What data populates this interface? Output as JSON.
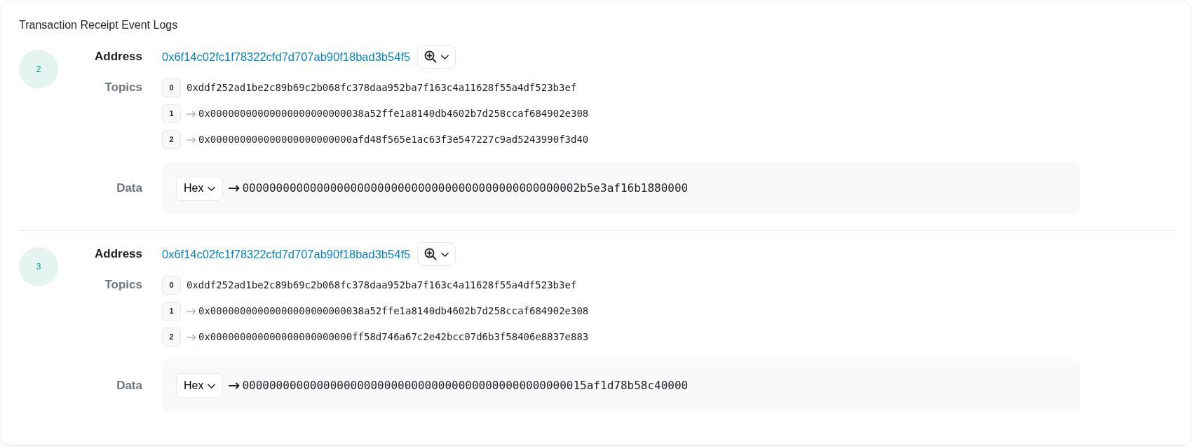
{
  "title": "Transaction Receipt Event Logs",
  "logs": [
    {
      "index": "2",
      "address_label": "Address",
      "address": "0x6f14c02fc1f78322cfd7d707ab90f18bad3b54f5",
      "topics_label": "Topics",
      "topics": [
        {
          "index": "0",
          "arrow": false,
          "value": "0xddf252ad1be2c89b69c2b068fc378daa952ba7f163c4a11628f55a4df523b3ef"
        },
        {
          "index": "1",
          "arrow": true,
          "value": "0x00000000000000000000000038a52ffe1a8140db4602b7d258ccaf684902e308"
        },
        {
          "index": "2",
          "arrow": true,
          "value": "0x000000000000000000000000afd48f565e1ac63f3e547227c9ad5243990f3d40"
        }
      ],
      "data_label": "Data",
      "data": {
        "format": "Hex",
        "value": "00000000000000000000000000000000000000000000000002b5e3af16b1880000"
      }
    },
    {
      "index": "3",
      "address_label": "Address",
      "address": "0x6f14c02fc1f78322cfd7d707ab90f18bad3b54f5",
      "topics_label": "Topics",
      "topics": [
        {
          "index": "0",
          "arrow": false,
          "value": "0xddf252ad1be2c89b69c2b068fc378daa952ba7f163c4a11628f55a4df523b3ef"
        },
        {
          "index": "1",
          "arrow": true,
          "value": "0x00000000000000000000000038a52ffe1a8140db4602b7d258ccaf684902e308"
        },
        {
          "index": "2",
          "arrow": true,
          "value": "0x000000000000000000000000ff58d746a67c2e42bcc07d6b3f58406e8837e883"
        }
      ],
      "data_label": "Data",
      "data": {
        "format": "Hex",
        "value": "000000000000000000000000000000000000000000000000015af1d78b58c40000"
      }
    }
  ]
}
